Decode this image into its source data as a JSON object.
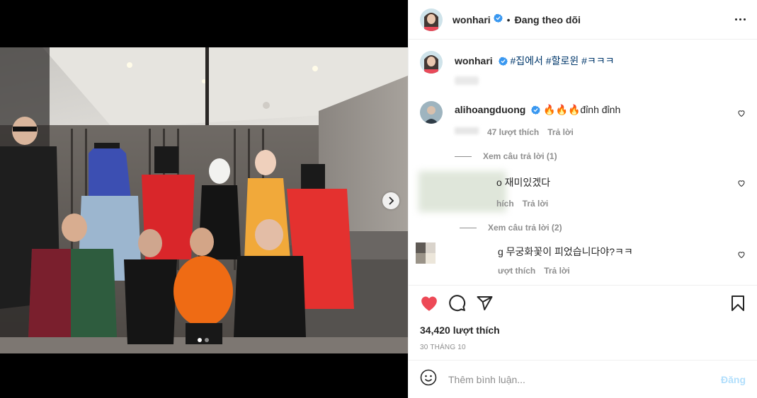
{
  "colors": {
    "liked_heart": "#ed4956",
    "link_blue": "#00376b",
    "verified_blue": "#3897f0",
    "muted": "#8e8e8e",
    "post_disabled": "#b2dffc"
  },
  "header": {
    "username": "wonhari",
    "separator": "•",
    "follow_label": "Đang theo dõi",
    "more_icon": "more-horizontal-icon"
  },
  "media": {
    "next_icon": "chevron-right-icon",
    "carousel": {
      "count": 2,
      "active_index": 0
    }
  },
  "caption": {
    "username": "wonhari",
    "hashtags": [
      "#집에서",
      "#할로윈",
      "#ㅋㅋㅋ"
    ]
  },
  "comments": [
    {
      "username": "alihoangduong",
      "text": "🔥🔥🔥đỉnh đỉnh",
      "likes": "47 lượt thích",
      "reply": "Trả lời",
      "view_replies": "Xem câu trả lời (1)"
    },
    {
      "username": "",
      "text": "o 재미있겠다",
      "likes": "",
      "reply": "Trả lời",
      "likes_partial": "hích",
      "view_replies": "Xem câu trả lời (2)"
    },
    {
      "username": "",
      "text": "g 무궁화꽃이 피었습니다야?ㅋㅋ",
      "likes_partial": "ượt thích",
      "reply": "Trả lời"
    }
  ],
  "actions": {
    "like_icon": "heart-filled-icon",
    "comment_icon": "comment-icon",
    "share_icon": "paper-plane-icon",
    "save_icon": "bookmark-icon"
  },
  "likes_count": "34,420 lượt thích",
  "date": "30 THÁNG 10",
  "add_comment": {
    "emoji_icon": "emoji-icon",
    "placeholder": "Thêm bình luận...",
    "post_label": "Đăng"
  }
}
